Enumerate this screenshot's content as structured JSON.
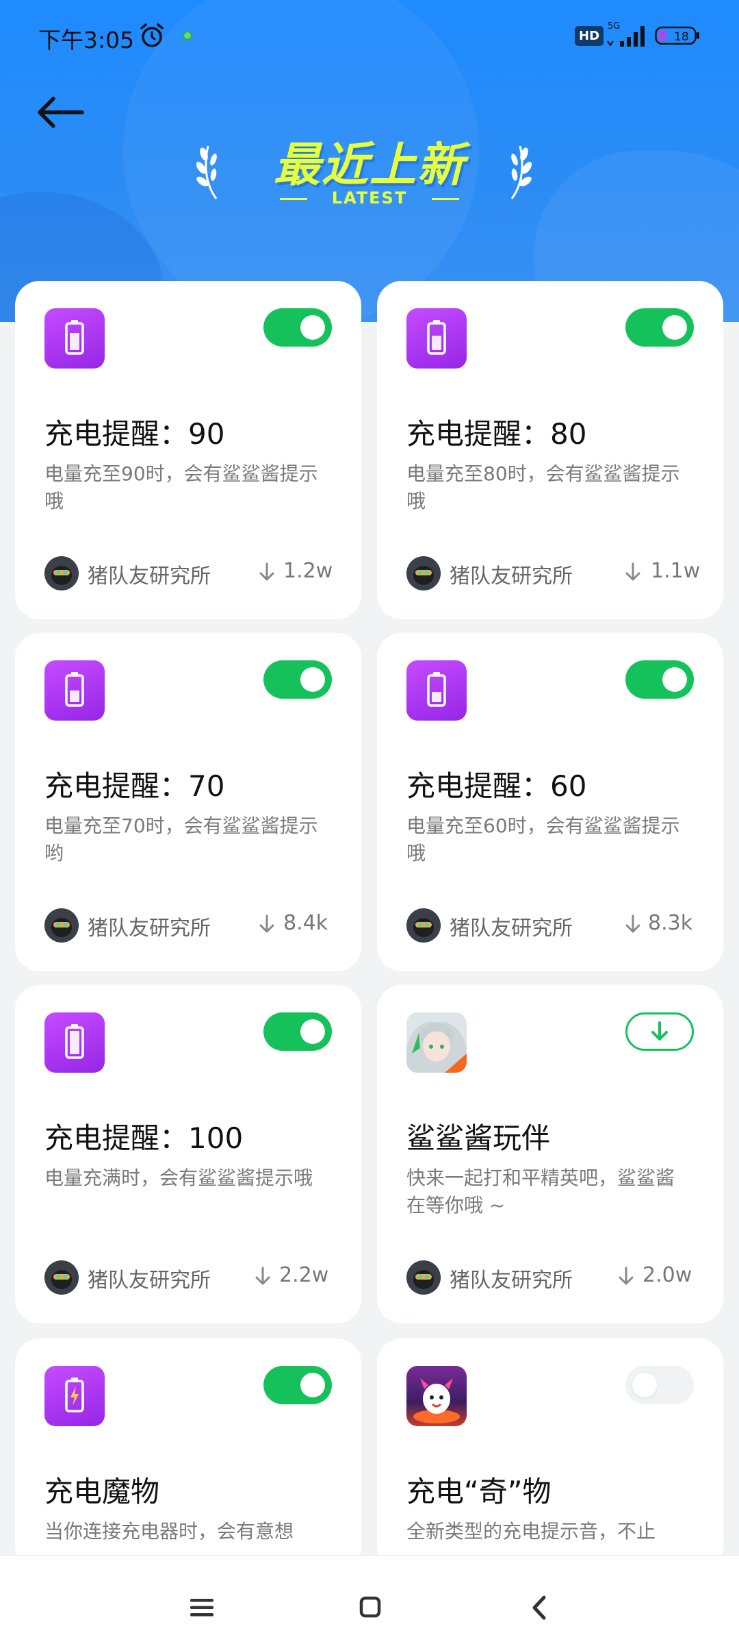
{
  "status_bar": {
    "time": "下午3:05",
    "hd_badge": "HD",
    "network": "5G",
    "battery": "18"
  },
  "header": {
    "title": "最近上新",
    "subtitle": "LATEST"
  },
  "cards": [
    {
      "title": "充电提醒：90",
      "description": "电量充至90时，会有鲨鲨酱提示哦",
      "author": "猪队友研究所",
      "downloads": "1.2w",
      "toggle": "on",
      "icon": "battery-icon"
    },
    {
      "title": "充电提醒：80",
      "description": "电量充至80时，会有鲨鲨酱提示哦",
      "author": "猪队友研究所",
      "downloads": "1.1w",
      "toggle": "on",
      "icon": "battery-icon"
    },
    {
      "title": "充电提醒：70",
      "description": "电量充至70时，会有鲨鲨酱提示哟",
      "author": "猪队友研究所",
      "downloads": "8.4k",
      "toggle": "on",
      "icon": "battery-icon"
    },
    {
      "title": "充电提醒：60",
      "description": "电量充至60时，会有鲨鲨酱提示哦",
      "author": "猪队友研究所",
      "downloads": "8.3k",
      "toggle": "on",
      "icon": "battery-icon"
    },
    {
      "title": "充电提醒：100",
      "description": "电量充满时，会有鲨鲨酱提示哦",
      "author": "猪队友研究所",
      "downloads": "2.2w",
      "toggle": "on",
      "icon": "battery-icon"
    },
    {
      "title": "鲨鲨酱玩伴",
      "description": "快来一起打和平精英吧，鲨鲨酱在等你哦 ~",
      "author": "猪队友研究所",
      "downloads": "2.0w",
      "toggle": "download",
      "icon": "anime-girl-icon"
    },
    {
      "title": "充电魔物",
      "description": "当你连接充电器时，会有意想",
      "toggle": "on",
      "icon": "charging-battery-icon"
    },
    {
      "title": "充电“奇”物",
      "description": "全新类型的充电提示音，不止",
      "toggle": "off",
      "icon": "monster-icon"
    }
  ],
  "colors": {
    "header_blue": "#1e8bff",
    "accent_green": "#15c15b",
    "title_yellow": "#e8ff3c",
    "icon_purple": "#a733f0"
  }
}
